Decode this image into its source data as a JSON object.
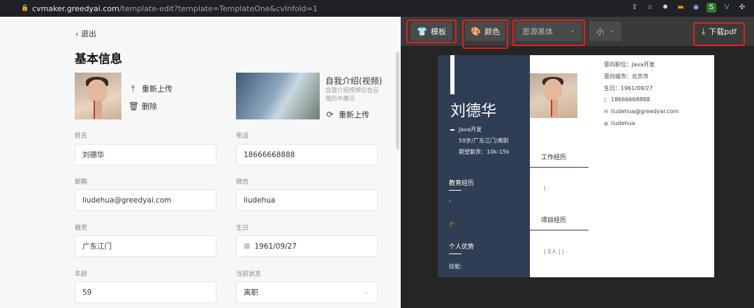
{
  "browser": {
    "url_host": "cvmaker.greedyai.com",
    "url_path": "/template-edit?template=TemplateOne&cvInfoId=1"
  },
  "editor": {
    "back_label": "退出",
    "section_title": "基本信息",
    "photo_actions": {
      "reupload": "重新上传",
      "delete": "删除"
    },
    "video": {
      "title": "自我介绍(视频)",
      "note": "自我介绍视频仅在云简历中展示",
      "reupload": "重新上传"
    },
    "fields": {
      "name": {
        "label": "姓名",
        "value": "刘德华"
      },
      "phone": {
        "label": "电话",
        "value": "18666668888"
      },
      "email": {
        "label": "邮箱",
        "value": "liudehua@greedyai.com"
      },
      "wechat": {
        "label": "微信",
        "value": "liudehua"
      },
      "origin": {
        "label": "籍贯",
        "value": "广东江门"
      },
      "birthday": {
        "label": "生日",
        "value": "1961/09/27"
      },
      "age": {
        "label": "年龄",
        "value": "59"
      },
      "status": {
        "label": "当前状态",
        "value": "离职"
      }
    }
  },
  "toolbar": {
    "template_label": "模板",
    "color_label": "颜色",
    "font_value": "思源黑体",
    "size_value": "小",
    "download_label": "下载pdf",
    "highlight_color": "#e0231a"
  },
  "resume": {
    "name": "刘德华",
    "job": "Java开发",
    "meta": "59岁/广东江门/离职",
    "salary": "期望薪资：10k-15k",
    "education_title": "教育经历",
    "education_value": "-",
    "strengths_title": "个人优势",
    "skills_label": "技能:",
    "intent_position": "意向职位：Java开发",
    "intent_city": "意向城市：北京市",
    "birthday": "生日：1961/09/27",
    "phone": "18666668888",
    "email": "liudehua@greedyai.com",
    "wechat": "liudehua",
    "work_title": "工作经历",
    "work_value": "| -",
    "project_title": "项目经历",
    "project_value": "| 0人 |  | -",
    "sidebar_color": "#2f3e52"
  }
}
